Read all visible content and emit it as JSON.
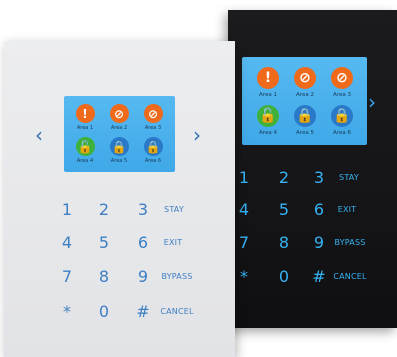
{
  "light_panel": {
    "screen": {
      "areas": [
        {
          "label": "Area 1",
          "icon": "alert-icon",
          "symbol": "!"
        },
        {
          "label": "Area 2",
          "icon": "bypass-icon",
          "symbol": "⊘"
        },
        {
          "label": "Area 3",
          "icon": "bypass-icon",
          "symbol": "⊘"
        },
        {
          "label": "Area 4",
          "icon": "unlock-icon",
          "symbol": "🔓"
        },
        {
          "label": "Area 5",
          "icon": "lock-icon",
          "symbol": "🔒"
        },
        {
          "label": "Area 6",
          "icon": "lock-icon",
          "symbol": "🔒"
        }
      ]
    },
    "chevron_left": "‹",
    "chevron_right": "›",
    "keys": [
      "1",
      "2",
      "3",
      "STAY",
      "4",
      "5",
      "6",
      "EXIT",
      "7",
      "8",
      "9",
      "BYPASS",
      "*",
      "0",
      "#",
      "CANCEL"
    ]
  },
  "dark_panel": {
    "screen": {
      "areas": [
        {
          "label": "Area 1",
          "icon": "alert-icon",
          "symbol": "!"
        },
        {
          "label": "Area 2",
          "icon": "bypass-icon",
          "symbol": "⊘"
        },
        {
          "label": "Area 3",
          "icon": "bypass-icon",
          "symbol": "⊘"
        },
        {
          "label": "Area 4",
          "icon": "unlock-icon",
          "symbol": "🔓"
        },
        {
          "label": "Area 5",
          "icon": "lock-icon",
          "symbol": "🔒"
        },
        {
          "label": "Area 6",
          "icon": "lock-icon",
          "symbol": "🔒"
        }
      ]
    },
    "chevron_right": "›",
    "keys": [
      "1",
      "2",
      "3",
      "STAY",
      "4",
      "5",
      "6",
      "EXIT",
      "7",
      "8",
      "9",
      "BYPASS",
      "*",
      "0",
      "#",
      "CANCEL"
    ]
  },
  "colors": {
    "screen_blue": "#4ab1ee",
    "alert_orange": "#ef6a1b",
    "unlock_green": "#3eb13a",
    "lock_blue": "#2a78c8",
    "key_light": "#3d7fc4",
    "key_dark": "#35b3f4"
  }
}
